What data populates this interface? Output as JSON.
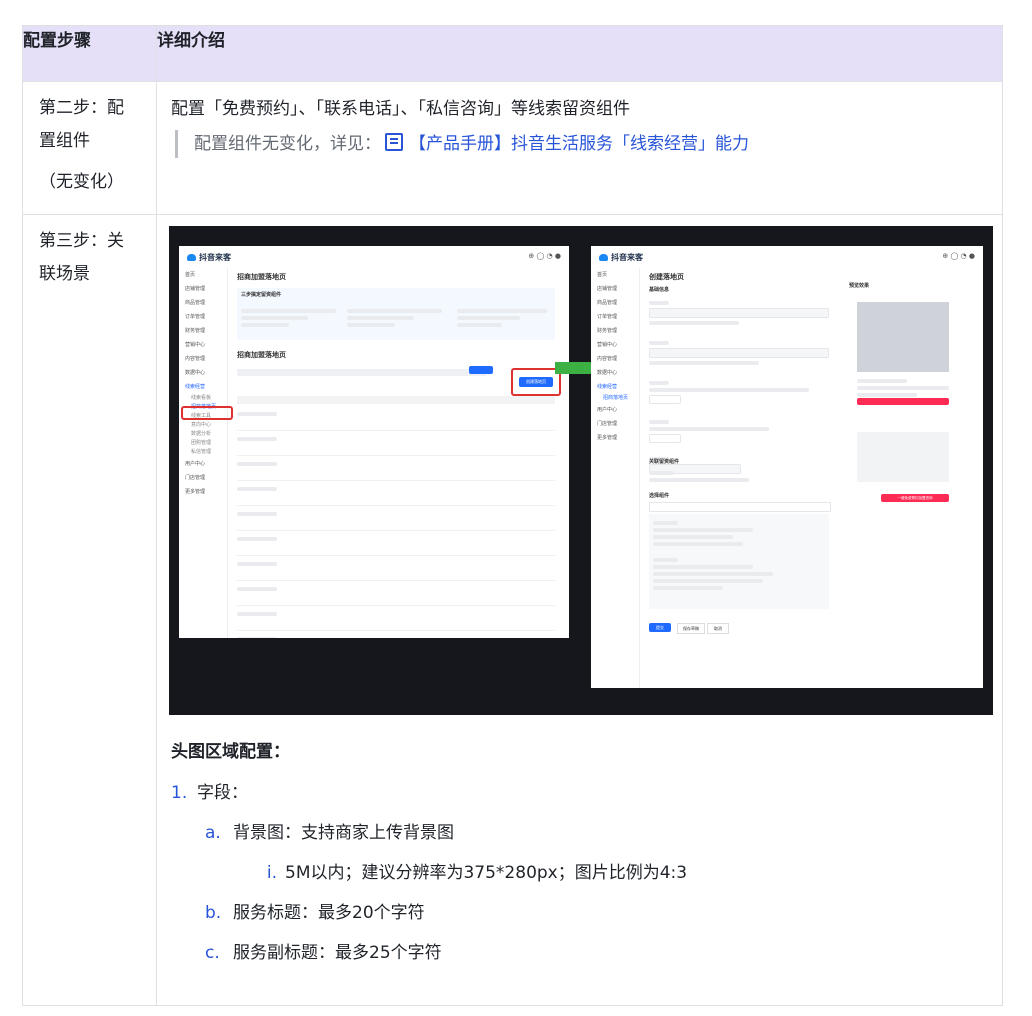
{
  "table": {
    "header": {
      "col1": "配置步骤",
      "col2": "详细介绍"
    },
    "row2": {
      "step_line1": "第二步：配",
      "step_line2": "置组件",
      "step_note": "（无变化）",
      "title": "配置「免费预约」、「联系电话」、「私信咨询」等线索留资组件",
      "quote_text": "配置组件无变化，详见：",
      "quote_link": "【产品手册】抖音生活服务「线索经营」能力",
      "link_icon": "doc-icon"
    },
    "row3": {
      "step_line1": "第三步：关",
      "step_line2": "联场景",
      "section_title": "头图区域配置：",
      "items": [
        {
          "num": "1.",
          "text": "字段："
        },
        {
          "num": "a.",
          "text": "背景图：支持商家上传背景图"
        },
        {
          "num": "i.",
          "text": "5M以内；建议分辨率为375*280px；图片比例为4:3"
        },
        {
          "num": "b.",
          "text": "服务标题：最多20个字符"
        },
        {
          "num": "c.",
          "text": "服务副标题：最多25个字符"
        }
      ]
    }
  },
  "screenshot": {
    "left_panel": {
      "brand": "抖音来客",
      "page_title": "招商加盟落地页",
      "section": "三步搞定留资组件",
      "list_title": "招商加盟落地页",
      "create_button": "创建落地页",
      "nav_items": [
        "首页",
        "店铺管理",
        "商品管理",
        "订单管理",
        "财务管理",
        "营销中心",
        "内容管理",
        "数据中心",
        "线索经营",
        "线索看板",
        "线索工具",
        "意向中心",
        "数据分析",
        "团购管理",
        "私信管理",
        "用户中心",
        "门店管理",
        "更多管理"
      ],
      "active_nav": "招商落地页"
    },
    "right_panel": {
      "brand": "抖音来客",
      "page_title": "创建落地页",
      "section_basic": "基础信息",
      "section_component": "关联留资组件",
      "section_select": "选择组件",
      "preview": "预览效果",
      "submit_button": "提交",
      "save_button": "保存草稿",
      "cancel_button": "取消",
      "cta_button": "一键免费预约加盟咨询"
    },
    "arrow_color": "#3cb043",
    "highlight_color": "#e03131",
    "accent": "#1f6bff"
  },
  "colors": {
    "header_bg": "#e5e0f7",
    "link": "#2855d8",
    "border": "#dee0e3"
  }
}
